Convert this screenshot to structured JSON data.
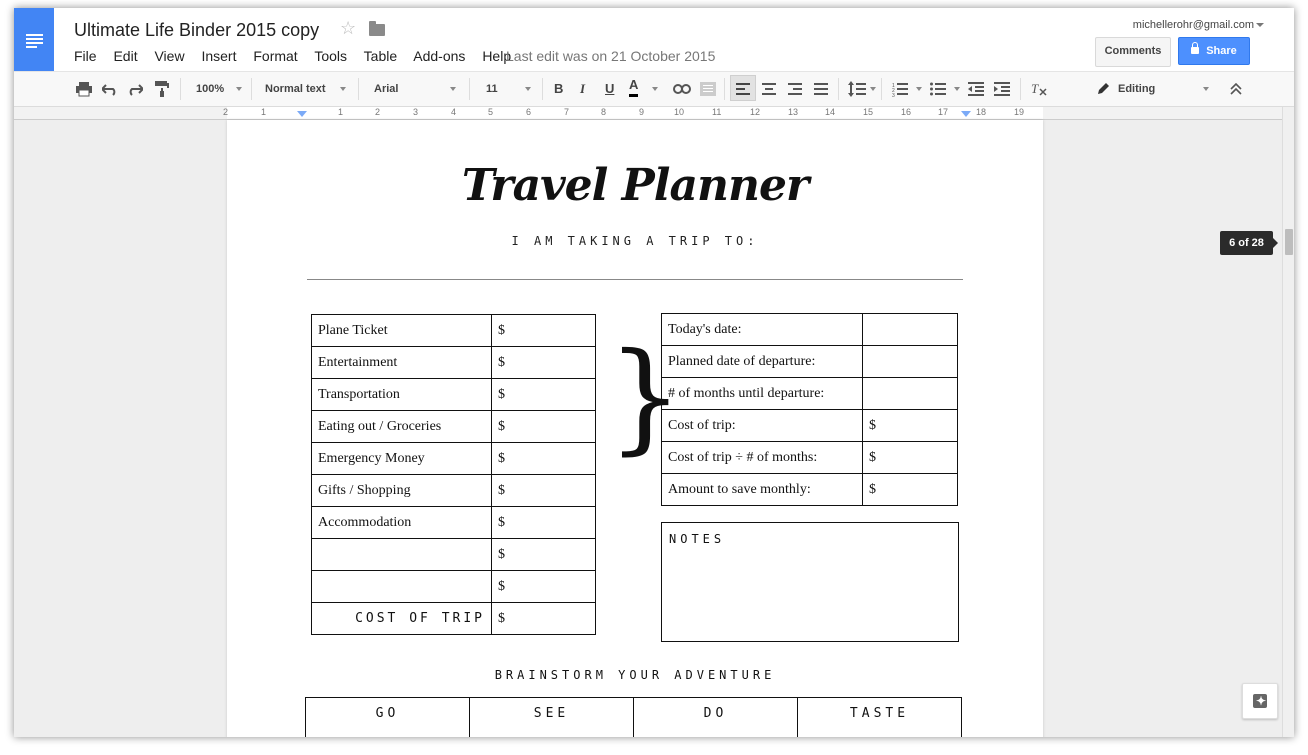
{
  "header": {
    "doc_title": "Ultimate Life Binder 2015 copy",
    "account_email": "michellerohr@gmail.com",
    "comments_label": "Comments",
    "share_label": "Share",
    "last_edit": "Last edit was on 21 October 2015",
    "menus": [
      "File",
      "Edit",
      "View",
      "Insert",
      "Format",
      "Tools",
      "Table",
      "Add-ons",
      "Help"
    ]
  },
  "toolbar": {
    "zoom": "100%",
    "style": "Normal text",
    "font": "Arial",
    "size": "11",
    "bold": "B",
    "italic": "I",
    "underline": "U",
    "text_color": "A",
    "mode": "Editing"
  },
  "ruler": {
    "labels": [
      "2",
      "1",
      "1",
      "2",
      "3",
      "4",
      "5",
      "6",
      "7",
      "8",
      "9",
      "10",
      "11",
      "12",
      "13",
      "14",
      "15",
      "16",
      "17",
      "18",
      "19"
    ]
  },
  "page_indicator": "6 of 28",
  "document": {
    "title": "Travel Planner",
    "subtitle": "I AM TAKING A TRIP TO:",
    "cost_rows": [
      {
        "label": "Plane Ticket",
        "value": "$"
      },
      {
        "label": "Entertainment",
        "value": "$"
      },
      {
        "label": "Transportation",
        "value": "$"
      },
      {
        "label": "Eating out / Groceries",
        "value": "$"
      },
      {
        "label": "Emergency Money",
        "value": "$"
      },
      {
        "label": "Gifts / Shopping",
        "value": "$"
      },
      {
        "label": "Accommodation",
        "value": "$"
      },
      {
        "label": "",
        "value": "$"
      },
      {
        "label": "",
        "value": "$"
      }
    ],
    "cost_total_label": "COST OF TRIP",
    "cost_total_value": "$",
    "brace": "}",
    "plan_rows": [
      {
        "label": "Today's date:",
        "value": ""
      },
      {
        "label": "Planned date of departure:",
        "value": ""
      },
      {
        "label": "# of months until departure:",
        "value": ""
      },
      {
        "label": "Cost of trip:",
        "value": "$"
      },
      {
        "label": "Cost of trip ÷ # of months:",
        "value": "$"
      },
      {
        "label": "Amount to save monthly:",
        "value": "$"
      }
    ],
    "notes_label": "NOTES",
    "brainstorm_title": "BRAINSTORM YOUR ADVENTURE",
    "brainstorm_cols": [
      "GO",
      "SEE",
      "DO",
      "TASTE"
    ]
  }
}
